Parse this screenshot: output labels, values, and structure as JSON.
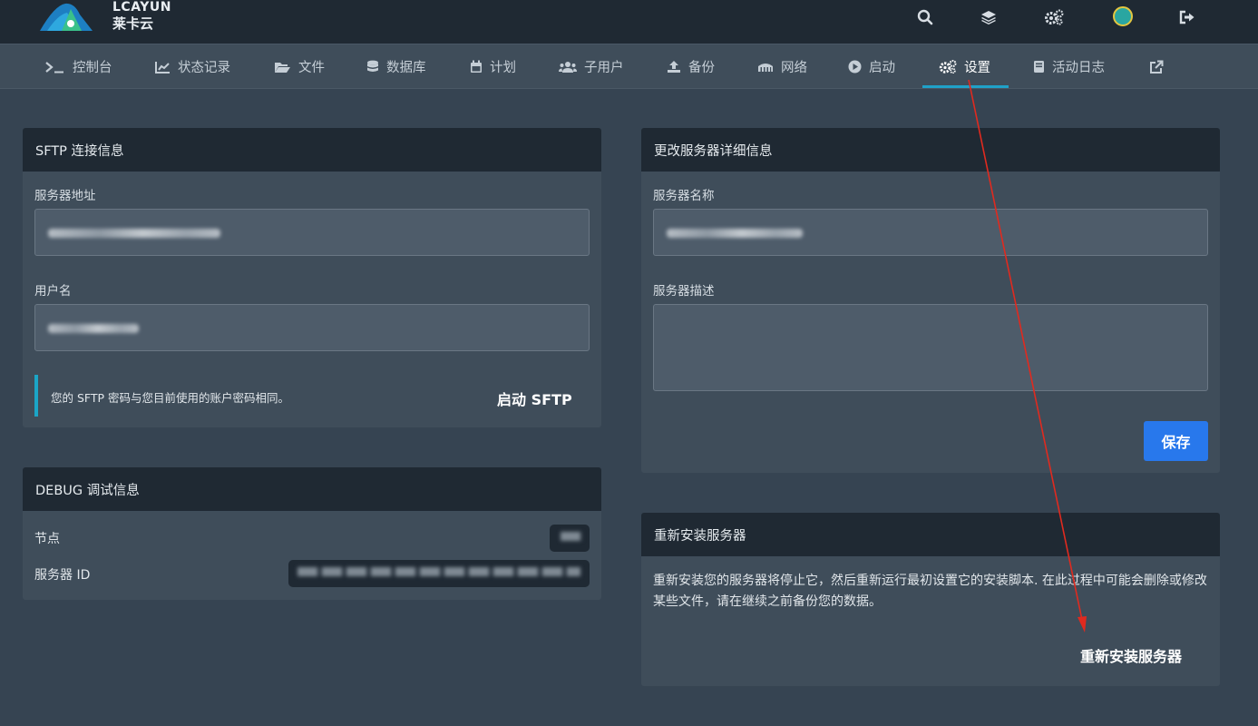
{
  "brand": {
    "logo_text": "LCAYUN",
    "logo_sub": "莱卡云"
  },
  "topbar": {
    "icons": [
      "search-icon",
      "layers-icon",
      "cogs-icon",
      "avatar",
      "sign-out-icon"
    ]
  },
  "nav": {
    "items": [
      {
        "label": "控制台",
        "icon": "terminal-icon"
      },
      {
        "label": "状态记录",
        "icon": "chart-line-icon"
      },
      {
        "label": "文件",
        "icon": "folder-open-icon"
      },
      {
        "label": "数据库",
        "icon": "database-icon"
      },
      {
        "label": "计划",
        "icon": "calendar-icon"
      },
      {
        "label": "子用户",
        "icon": "users-icon"
      },
      {
        "label": "备份",
        "icon": "upload-icon"
      },
      {
        "label": "网络",
        "icon": "network-icon"
      },
      {
        "label": "启动",
        "icon": "play-circle-icon"
      },
      {
        "label": "设置",
        "icon": "cogs-icon",
        "active": true
      },
      {
        "label": "活动日志",
        "icon": "book-icon"
      },
      {
        "label": "",
        "icon": "external-link-icon"
      }
    ]
  },
  "sftp": {
    "title": "SFTP 连接信息",
    "server_address_label": "服务器地址",
    "username_label": "用户名",
    "notice": "您的 SFTP 密码与您目前使用的账户密码相同。",
    "launch_label": "启动 SFTP"
  },
  "debug": {
    "title": "DEBUG 调试信息",
    "node_label": "节点",
    "server_id_label": "服务器 ID"
  },
  "details": {
    "title": "更改服务器详细信息",
    "name_label": "服务器名称",
    "description_label": "服务器描述",
    "save_label": "保存"
  },
  "reinstall": {
    "title": "重新安装服务器",
    "description": "重新安装您的服务器将停止它，然后重新运行最初设置它的安装脚本. 在此过程中可能会删除或修改某些文件，请在继续之前备份您的数据。",
    "button_label": "重新安装服务器"
  },
  "colors": {
    "background": "#364452",
    "card": "#3f4d5a",
    "card_header": "#1f2933",
    "accent": "#1fa1c8",
    "primary_button": "#2878ec",
    "annotation_arrow": "#e02a1f"
  }
}
